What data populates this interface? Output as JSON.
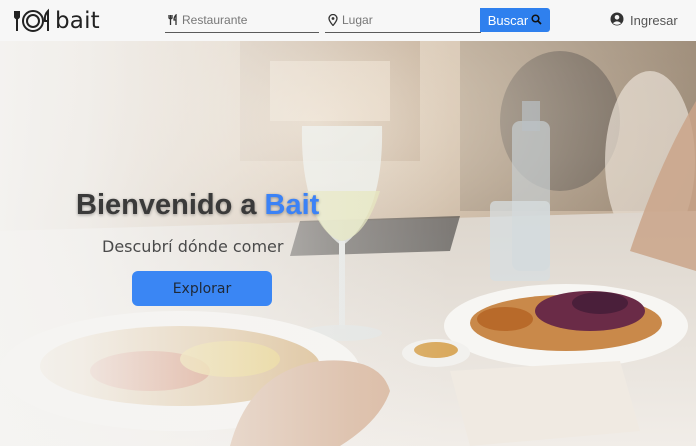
{
  "header": {
    "logo_text": "bait",
    "search": {
      "restaurant_placeholder": "Restaurante",
      "restaurant_value": "",
      "place_placeholder": "Lugar",
      "place_value": "",
      "button_label": "Buscar"
    },
    "login_label": "Ingresar"
  },
  "hero": {
    "welcome_prefix": "Bienvenido a ",
    "welcome_brand": "Bait",
    "tagline": "Descubrí dónde comer",
    "cta_label": "Explorar"
  },
  "colors": {
    "accent": "#2f80ee",
    "brand_text": "#3b82f6",
    "header_bg": "#f7f7f7"
  },
  "icons": [
    "plate-fork-knife-logo-icon",
    "fork-knife-icon",
    "map-pin-icon",
    "search-icon",
    "user-circle-icon"
  ]
}
